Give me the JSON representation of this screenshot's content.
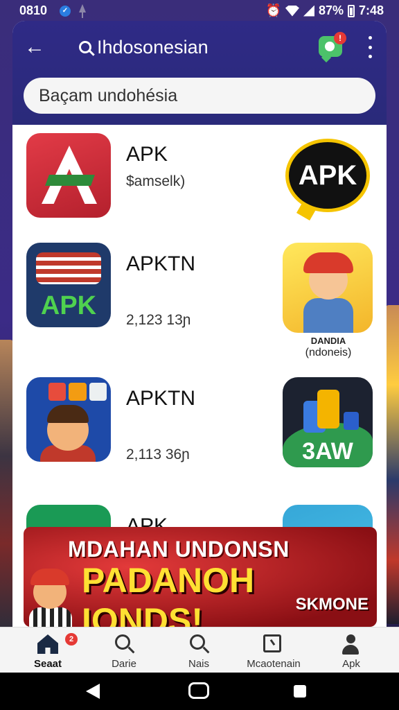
{
  "status_bar": {
    "time_left": "0810",
    "battery_percent": "87%",
    "time_right": "7:48"
  },
  "header": {
    "back_glyph": "←",
    "title": "Ihdosonesian",
    "notification_count": "!"
  },
  "search": {
    "value": "Baçam undohésia"
  },
  "apps": [
    {
      "title": "APK",
      "subtitle": "$amselk)"
    },
    {
      "title": "APKTN",
      "subtitle": "2,123 13ɲ"
    },
    {
      "title": "APKTN",
      "subtitle": "2,113 36ɲ"
    },
    {
      "title": "APK",
      "subtitle": ""
    }
  ],
  "promos": [
    {
      "label": "APK"
    },
    {
      "caption_title": "DANDIA",
      "caption_sub": "(ndoneis)"
    },
    {
      "label": "3AW"
    }
  ],
  "icon_labels": {
    "apk_blue": "APK"
  },
  "ad": {
    "line1": "MDAHAN UNDONSN",
    "line2": "PADANOH IONDS!",
    "line3": "SKMONE"
  },
  "bottom_nav": {
    "items": [
      {
        "label": "Seaat",
        "icon": "home-icon",
        "badge": "2",
        "active": true
      },
      {
        "label": "Darie",
        "icon": "search-icon"
      },
      {
        "label": "Nais",
        "icon": "search-icon"
      },
      {
        "label": "Mcaotenain",
        "icon": "clock-icon"
      },
      {
        "label": "Apk",
        "icon": "person-icon"
      }
    ]
  },
  "colors": {
    "header": "#2f2a86",
    "accent_red": "#e53935",
    "ad_yellow": "#ffe033"
  }
}
